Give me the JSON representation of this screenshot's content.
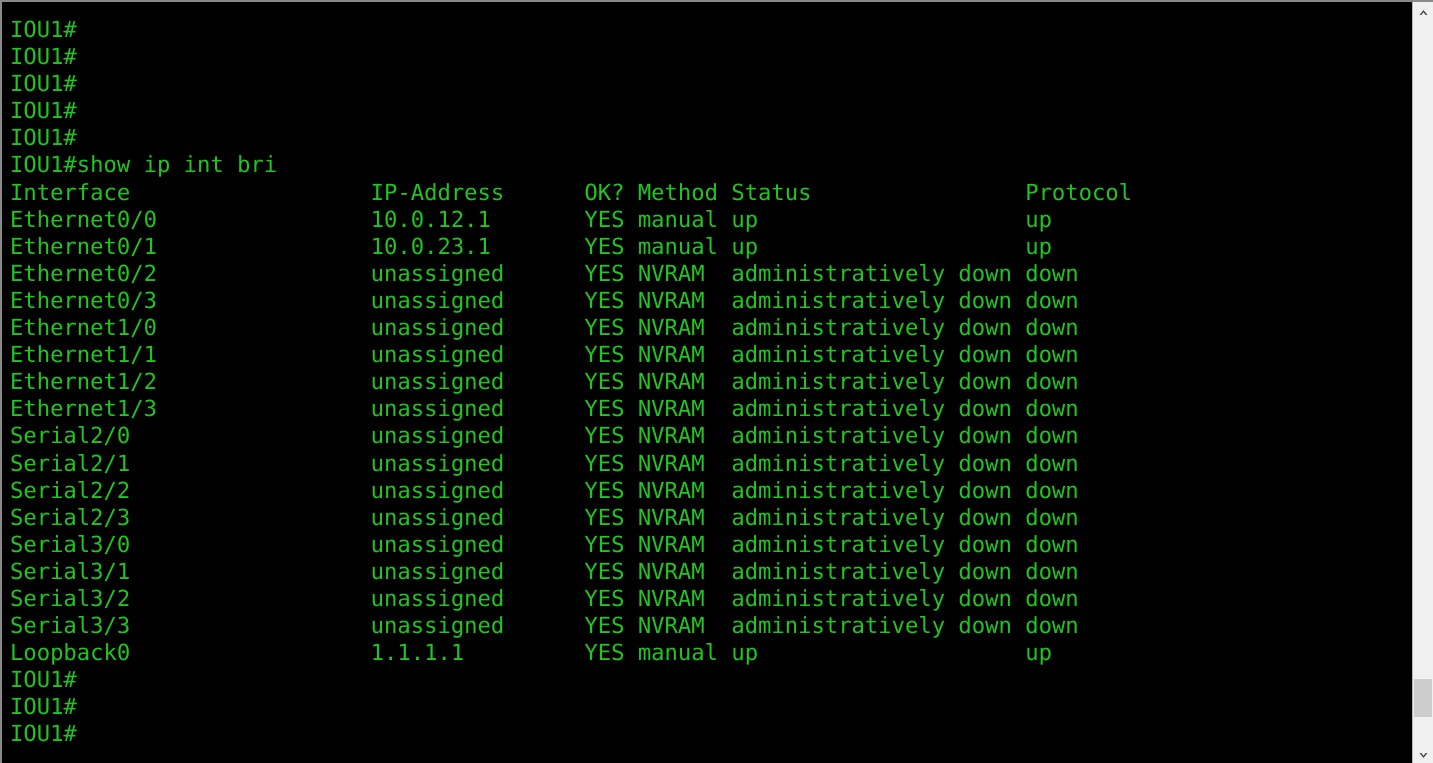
{
  "terminal": {
    "prompt": "IOU1#",
    "command": "show ip int bri",
    "command_line": "IOU1#show ip int bri",
    "columns": {
      "interface": "Interface",
      "ip_address": "IP-Address",
      "ok": "OK?",
      "method": "Method",
      "status": "Status",
      "protocol": "Protocol"
    },
    "header_line": "Interface                  IP-Address      OK? Method Status                Protocol",
    "foreground_color": "#21c421",
    "background_color": "#000000",
    "rows": [
      {
        "interface": "Ethernet0/0",
        "ip_address": "10.0.12.1",
        "ok": "YES",
        "method": "manual",
        "status": "up",
        "protocol": "up"
      },
      {
        "interface": "Ethernet0/1",
        "ip_address": "10.0.23.1",
        "ok": "YES",
        "method": "manual",
        "status": "up",
        "protocol": "up"
      },
      {
        "interface": "Ethernet0/2",
        "ip_address": "unassigned",
        "ok": "YES",
        "method": "NVRAM",
        "status": "administratively down",
        "protocol": "down"
      },
      {
        "interface": "Ethernet0/3",
        "ip_address": "unassigned",
        "ok": "YES",
        "method": "NVRAM",
        "status": "administratively down",
        "protocol": "down"
      },
      {
        "interface": "Ethernet1/0",
        "ip_address": "unassigned",
        "ok": "YES",
        "method": "NVRAM",
        "status": "administratively down",
        "protocol": "down"
      },
      {
        "interface": "Ethernet1/1",
        "ip_address": "unassigned",
        "ok": "YES",
        "method": "NVRAM",
        "status": "administratively down",
        "protocol": "down"
      },
      {
        "interface": "Ethernet1/2",
        "ip_address": "unassigned",
        "ok": "YES",
        "method": "NVRAM",
        "status": "administratively down",
        "protocol": "down"
      },
      {
        "interface": "Ethernet1/3",
        "ip_address": "unassigned",
        "ok": "YES",
        "method": "NVRAM",
        "status": "administratively down",
        "protocol": "down"
      },
      {
        "interface": "Serial2/0",
        "ip_address": "unassigned",
        "ok": "YES",
        "method": "NVRAM",
        "status": "administratively down",
        "protocol": "down"
      },
      {
        "interface": "Serial2/1",
        "ip_address": "unassigned",
        "ok": "YES",
        "method": "NVRAM",
        "status": "administratively down",
        "protocol": "down"
      },
      {
        "interface": "Serial2/2",
        "ip_address": "unassigned",
        "ok": "YES",
        "method": "NVRAM",
        "status": "administratively down",
        "protocol": "down"
      },
      {
        "interface": "Serial2/3",
        "ip_address": "unassigned",
        "ok": "YES",
        "method": "NVRAM",
        "status": "administratively down",
        "protocol": "down"
      },
      {
        "interface": "Serial3/0",
        "ip_address": "unassigned",
        "ok": "YES",
        "method": "NVRAM",
        "status": "administratively down",
        "protocol": "down"
      },
      {
        "interface": "Serial3/1",
        "ip_address": "unassigned",
        "ok": "YES",
        "method": "NVRAM",
        "status": "administratively down",
        "protocol": "down"
      },
      {
        "interface": "Serial3/2",
        "ip_address": "unassigned",
        "ok": "YES",
        "method": "NVRAM",
        "status": "administratively down",
        "protocol": "down"
      },
      {
        "interface": "Serial3/3",
        "ip_address": "unassigned",
        "ok": "YES",
        "method": "NVRAM",
        "status": "administratively down",
        "protocol": "down"
      },
      {
        "interface": "Loopback0",
        "ip_address": "1.1.1.1",
        "ok": "YES",
        "method": "manual",
        "status": "up",
        "protocol": "up"
      }
    ],
    "lines": [
      "IOU1#",
      "IOU1#",
      "IOU1#",
      "IOU1#",
      "IOU1#",
      "IOU1#show ip int bri",
      "Interface                  IP-Address      OK? Method Status                Protocol",
      "Ethernet0/0                10.0.12.1       YES manual up                    up",
      "Ethernet0/1                10.0.23.1       YES manual up                    up",
      "Ethernet0/2                unassigned      YES NVRAM  administratively down down",
      "Ethernet0/3                unassigned      YES NVRAM  administratively down down",
      "Ethernet1/0                unassigned      YES NVRAM  administratively down down",
      "Ethernet1/1                unassigned      YES NVRAM  administratively down down",
      "Ethernet1/2                unassigned      YES NVRAM  administratively down down",
      "Ethernet1/3                unassigned      YES NVRAM  administratively down down",
      "Serial2/0                  unassigned      YES NVRAM  administratively down down",
      "Serial2/1                  unassigned      YES NVRAM  administratively down down",
      "Serial2/2                  unassigned      YES NVRAM  administratively down down",
      "Serial2/3                  unassigned      YES NVRAM  administratively down down",
      "Serial3/0                  unassigned      YES NVRAM  administratively down down",
      "Serial3/1                  unassigned      YES NVRAM  administratively down down",
      "Serial3/2                  unassigned      YES NVRAM  administratively down down",
      "Serial3/3                  unassigned      YES NVRAM  administratively down down",
      "Loopback0                  1.1.1.1         YES manual up                    up",
      "IOU1#",
      "IOU1#",
      "IOU1#"
    ]
  },
  "scrollbar": {
    "up_arrow": "scroll-up-arrow",
    "down_arrow": "scroll-down-arrow",
    "thumb_position_percent": 96
  }
}
